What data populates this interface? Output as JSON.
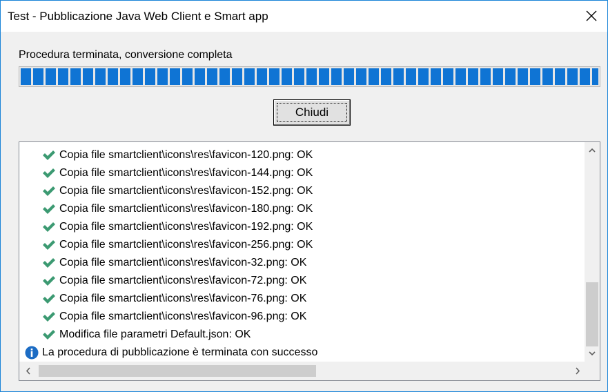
{
  "window": {
    "title": "Test - Pubblicazione Java Web Client e Smart app",
    "close_glyph": "✕"
  },
  "status": {
    "text": "Procedura terminata, conversione completa",
    "progress_percent": 100,
    "progress_color": "#0f74d4"
  },
  "buttons": {
    "chiudi_label": "Chiudi"
  },
  "log": {
    "items": [
      {
        "icon": "check-icon",
        "text": "Copia file smartclient\\icons\\res\\favicon-120.png: OK"
      },
      {
        "icon": "check-icon",
        "text": "Copia file smartclient\\icons\\res\\favicon-144.png: OK"
      },
      {
        "icon": "check-icon",
        "text": "Copia file smartclient\\icons\\res\\favicon-152.png: OK"
      },
      {
        "icon": "check-icon",
        "text": "Copia file smartclient\\icons\\res\\favicon-180.png: OK"
      },
      {
        "icon": "check-icon",
        "text": "Copia file smartclient\\icons\\res\\favicon-192.png: OK"
      },
      {
        "icon": "check-icon",
        "text": "Copia file smartclient\\icons\\res\\favicon-256.png: OK"
      },
      {
        "icon": "check-icon",
        "text": "Copia file smartclient\\icons\\res\\favicon-32.png: OK"
      },
      {
        "icon": "check-icon",
        "text": "Copia file smartclient\\icons\\res\\favicon-72.png: OK"
      },
      {
        "icon": "check-icon",
        "text": "Copia file smartclient\\icons\\res\\favicon-76.png: OK"
      },
      {
        "icon": "check-icon",
        "text": "Copia file smartclient\\icons\\res\\favicon-96.png: OK"
      },
      {
        "icon": "check-icon",
        "text": "Modifica file parametri Default.json: OK"
      },
      {
        "icon": "info-icon",
        "text": "La procedura di pubblicazione è terminata con successo"
      }
    ],
    "check_color": "#3c9a72",
    "info_color": "#1c6cc4"
  }
}
